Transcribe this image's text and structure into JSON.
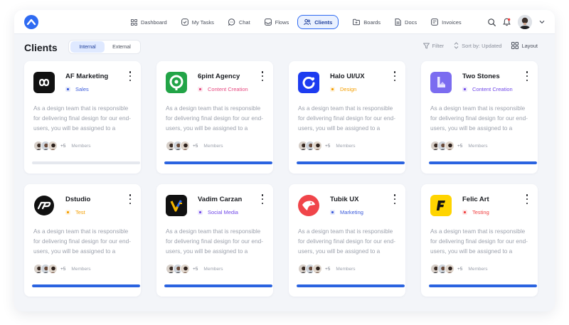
{
  "nav": {
    "items": [
      {
        "label": "Dashboard",
        "icon": "grid-icon"
      },
      {
        "label": "My Tasks",
        "icon": "check-circle-icon"
      },
      {
        "label": "Chat",
        "icon": "chat-bubble-icon"
      },
      {
        "label": "Flows",
        "icon": "inbox-icon"
      },
      {
        "label": "Clients",
        "icon": "users-icon",
        "active": true
      },
      {
        "label": "Boards",
        "icon": "folder-icon"
      },
      {
        "label": "Docs",
        "icon": "document-icon"
      },
      {
        "label": "Invoices",
        "icon": "invoice-icon"
      }
    ]
  },
  "header": {
    "title": "Clients",
    "segments": [
      "Internal",
      "External"
    ],
    "active_segment": "Internal",
    "filter_label": "Filter",
    "sort_label": "Sort by: Updated",
    "layout_label": "Layout"
  },
  "colors": {
    "accent": "#2f6bf2",
    "progress": "#2a63e0"
  },
  "clients": [
    {
      "name": "AF Marketing",
      "tag": "Sales",
      "tag_color": "#3b5bdb",
      "logo": "af-marketing-logo",
      "desc": "As a design team that is responsible for delivering final design for our end-users, you will be assigned to a",
      "members_more": "+5",
      "members_label": "Members",
      "progress": 0
    },
    {
      "name": "6pint Agency",
      "tag": "Content Creation",
      "tag_color": "#e64980",
      "logo": "6pint-logo",
      "desc": "As a design team that is responsible for delivering final design for our end-users, you will be assigned to a",
      "members_more": "+5",
      "members_label": "Members",
      "progress": 1
    },
    {
      "name": "Halo UI/UX",
      "tag": "Design",
      "tag_color": "#f59f00",
      "logo": "halo-logo",
      "desc": "As a design team that is responsible for delivering final design for our end-users, you will be assigned to a",
      "members_more": "+5",
      "members_label": "Members",
      "progress": 1
    },
    {
      "name": "Two Stones",
      "tag": "Content Creation",
      "tag_color": "#7048e8",
      "logo": "two-stones-logo",
      "desc": "As a design team that is responsible for delivering final design for our end-users, you will be assigned to a",
      "members_more": "+5",
      "members_label": "Members",
      "progress": 1
    },
    {
      "name": "Dstudio",
      "tag": "Test",
      "tag_color": "#f59f00",
      "logo": "dstudio-logo",
      "desc": "As a design team that is responsible for delivering final design for our end-users, you will be assigned to a",
      "members_more": "+5",
      "members_label": "Members",
      "progress": 1
    },
    {
      "name": "Vadim Carzan",
      "tag": "Social Media",
      "tag_color": "#7048e8",
      "logo": "vadim-carzan-logo",
      "desc": "As a design team that is responsible for delivering final design for our end-users, you will be assigned to a",
      "members_more": "+5",
      "members_label": "Members",
      "progress": 1
    },
    {
      "name": "Tubik UX",
      "tag": "Marketing",
      "tag_color": "#3b5bdb",
      "logo": "tubik-logo",
      "desc": "As a design team that is responsible for delivering final design for our end-users, you will be assigned to a",
      "members_more": "+5",
      "members_label": "Members",
      "progress": 1
    },
    {
      "name": "Felic Art",
      "tag": "Testing",
      "tag_color": "#f03e3e",
      "logo": "felic-art-logo",
      "desc": "As a design team that is responsible for delivering final design for our end-users, you will be assigned to a",
      "members_more": "+5",
      "members_label": "Members",
      "progress": 1
    }
  ]
}
